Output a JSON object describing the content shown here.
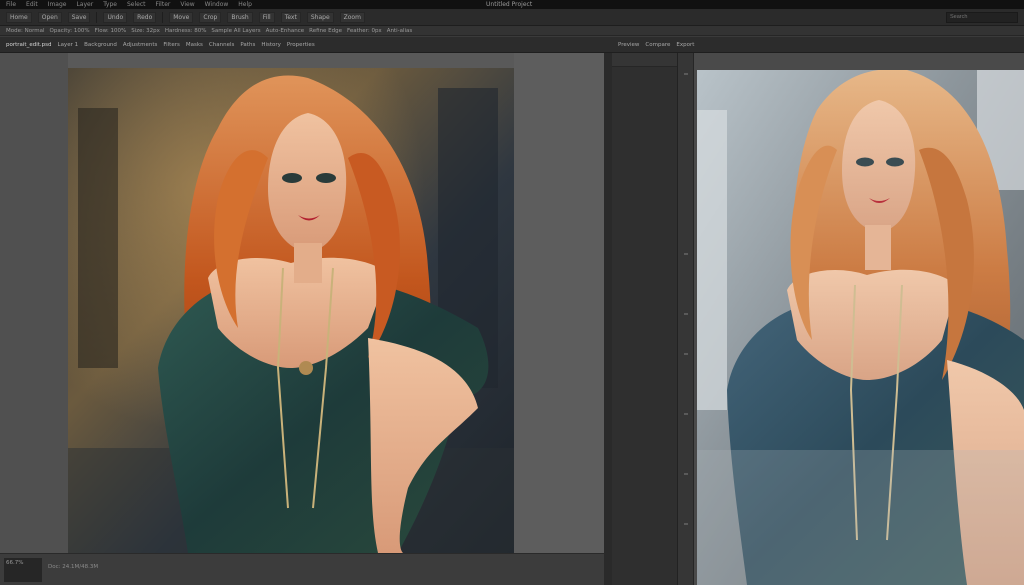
{
  "menubar": {
    "items": [
      "File",
      "Edit",
      "Image",
      "Layer",
      "Type",
      "Select",
      "Filter",
      "View",
      "Window",
      "Help"
    ],
    "title": "Untitled Project"
  },
  "toolbar": {
    "buttons": [
      "Home",
      "Open",
      "Save",
      "Undo",
      "Redo",
      "Move",
      "Crop",
      "Brush",
      "Fill",
      "Text",
      "Shape",
      "Zoom"
    ],
    "search_placeholder": "Search"
  },
  "options": {
    "items": [
      "Mode: Normal",
      "Opacity: 100%",
      "Flow: 100%",
      "Size: 32px",
      "Hardness: 80%",
      "Sample All Layers",
      "Auto-Enhance",
      "Refine Edge",
      "Feather: 0px",
      "Anti-alias"
    ]
  },
  "tabs": {
    "left": [
      "portrait_edit.psd",
      "Layer 1",
      "Background",
      "Adjustments",
      "Filters",
      "Masks",
      "Channels",
      "Paths",
      "History",
      "Properties"
    ],
    "right": [
      "Preview",
      "Compare",
      "Export"
    ]
  },
  "status": {
    "zoom": "66.7%",
    "info": "Doc: 24.1M/48.3M"
  },
  "colors": {
    "accent": "#4a90d9",
    "chrome_dark": "#2b2b2b"
  }
}
